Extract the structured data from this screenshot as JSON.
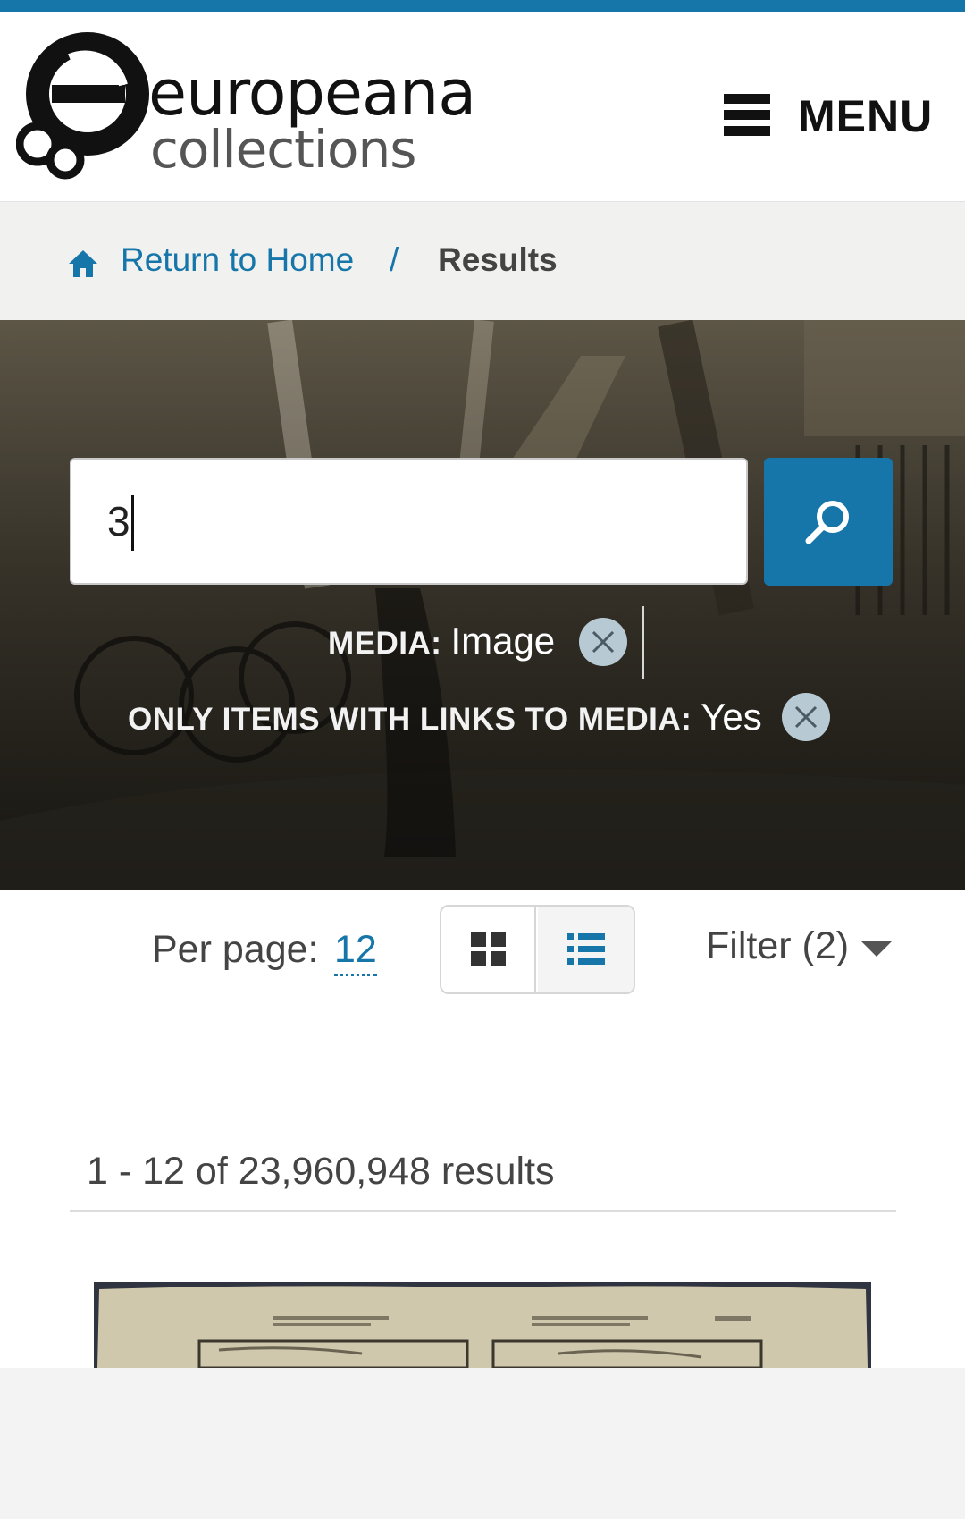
{
  "header": {
    "logo_line1": "europeana",
    "logo_line2": "collections",
    "menu_label": "MENU",
    "menu_icon": "hamburger-icon"
  },
  "breadcrumb": {
    "home_icon": "home-icon",
    "home_label": "Return to Home",
    "separator": "/",
    "current": "Results"
  },
  "search": {
    "query": "3",
    "button_icon": "search-icon"
  },
  "facets": [
    {
      "key": "MEDIA:",
      "value": "Image",
      "remove_icon": "close-icon"
    },
    {
      "key": "ONLY ITEMS WITH LINKS TO MEDIA:",
      "value": "Yes",
      "remove_icon": "close-icon"
    }
  ],
  "toolbar": {
    "per_page_label": "Per page:",
    "per_page_value": "12",
    "grid_view_icon": "grid-view-icon",
    "list_view_icon": "list-view-icon",
    "filter_label": "Filter (2)",
    "filter_icon": "caret-down-icon"
  },
  "results": {
    "count_text": "1 - 12 of 23,960,948 results"
  },
  "colors": {
    "brand_blue": "#1676aa",
    "chip_grey": "#b7c9d2"
  }
}
